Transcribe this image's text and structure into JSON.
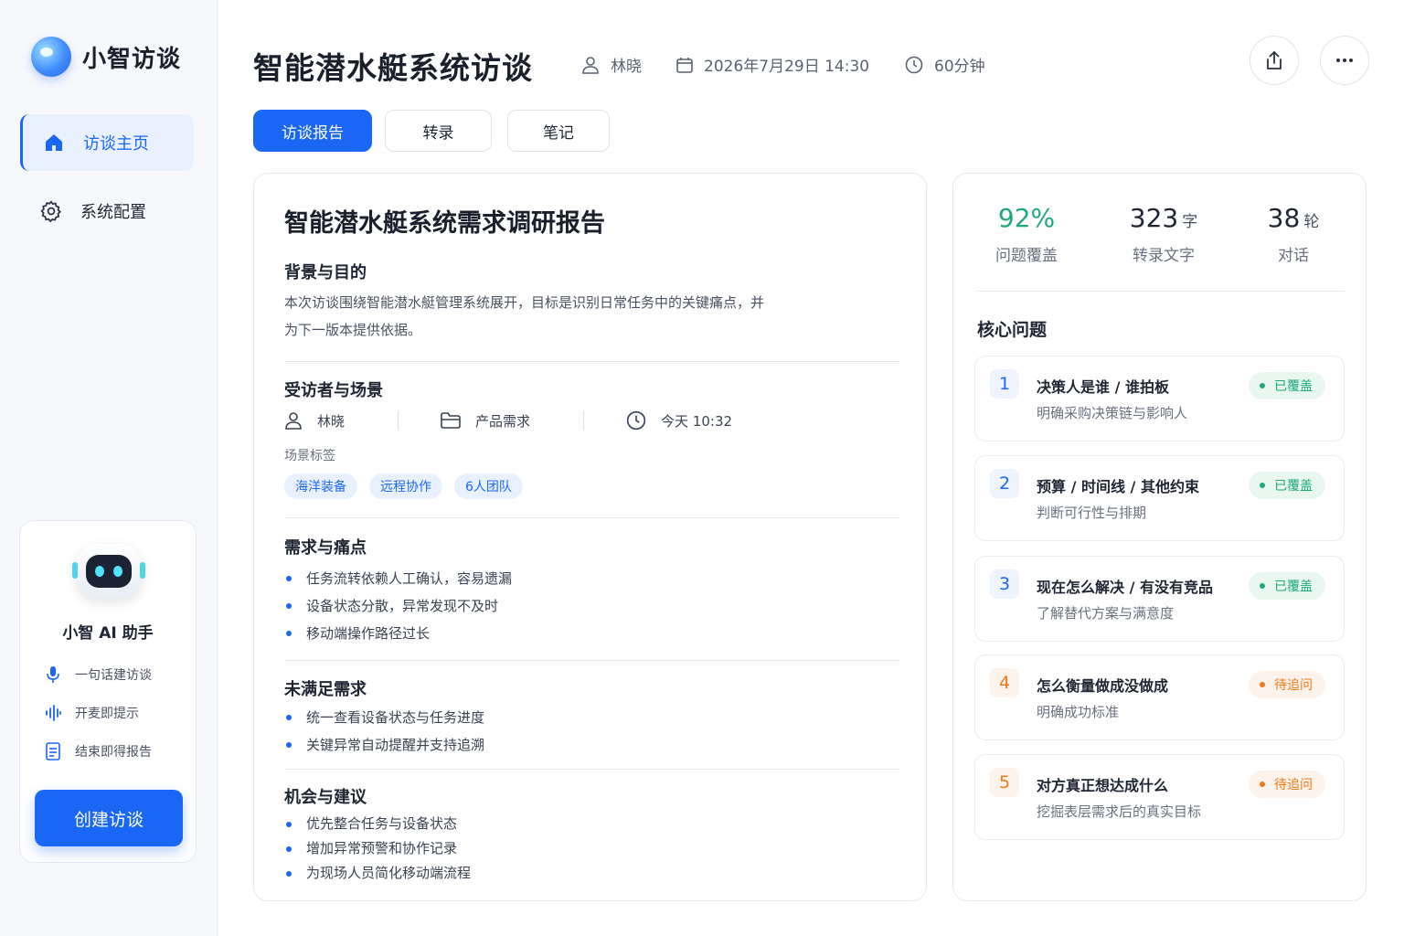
{
  "brand": {
    "name": "小智访谈"
  },
  "nav": [
    {
      "label": "访谈主页",
      "icon": "home-icon",
      "active": true
    },
    {
      "label": "系统配置",
      "icon": "gear-icon",
      "active": false
    }
  ],
  "assistant": {
    "name": "小智 AI 助手",
    "features": [
      {
        "label": "一句话建访谈",
        "icon": "microphone-icon"
      },
      {
        "label": "开麦即提示",
        "icon": "sound-wave-icon"
      },
      {
        "label": "结束即得报告",
        "icon": "document-icon"
      }
    ],
    "create_label": "创建访谈"
  },
  "header": {
    "title": "智能潜水艇系统访谈",
    "interviewer": "林晓",
    "datetime": "2026年7月29日 14:30",
    "duration": "60分钟"
  },
  "tabs": [
    {
      "label": "访谈报告",
      "active": true
    },
    {
      "label": "转录",
      "active": false
    },
    {
      "label": "笔记",
      "active": false
    }
  ],
  "report": {
    "title": "智能潜水艇系统需求调研报告",
    "background": {
      "heading": "背景与目的",
      "line1": "本次访谈围绕智能潜水艇管理系统展开，目标是识别日常任务中的关键痛点，并",
      "line2": "为下一版本提供依据。"
    },
    "interviewee": {
      "heading": "受访者与场景",
      "name": "林晓",
      "category": "产品需求",
      "time": "今天 10:32",
      "tags_label": "场景标签",
      "tags": [
        "海洋装备",
        "远程协作",
        "6人团队"
      ]
    },
    "pain_points": {
      "heading": "需求与痛点",
      "items": [
        "任务流转依赖人工确认，容易遗漏",
        "设备状态分散，异常发现不及时",
        "移动端操作路径过长"
      ]
    },
    "unmet": {
      "heading": "未满足需求",
      "items": [
        "统一查看设备状态与任务进度",
        "关键异常自动提醒并支持追溯"
      ]
    },
    "opportunities": {
      "heading": "机会与建议",
      "items": [
        "优先整合任务与设备状态",
        "增加异常预警和协作记录",
        "为现场人员简化移动端流程"
      ]
    }
  },
  "stats": [
    {
      "value": "92%",
      "unit": "",
      "label": "问题覆盖"
    },
    {
      "value": "323",
      "unit": "字",
      "label": "转录文字"
    },
    {
      "value": "38",
      "unit": "轮",
      "label": "对话"
    }
  ],
  "core": {
    "heading": "核心问题",
    "questions": [
      {
        "num": "1",
        "title": "决策人是谁 / 谁拍板",
        "sub": "明确采购决策链与影响人",
        "status": "已覆盖"
      },
      {
        "num": "2",
        "title": "预算 / 时间线 / 其他约束",
        "sub": "判断可行性与排期",
        "status": "已覆盖"
      },
      {
        "num": "3",
        "title": "现在怎么解决 / 有没有竞品",
        "sub": "了解替代方案与满意度",
        "status": "已覆盖"
      },
      {
        "num": "4",
        "title": "怎么衡量做成没做成",
        "sub": "明确成功标准",
        "status": "待追问"
      },
      {
        "num": "5",
        "title": "对方真正想达成什么",
        "sub": "挖掘表层需求后的真实目标",
        "status": "待追问"
      }
    ]
  },
  "colors": {
    "accent": "#1a66f5",
    "covered": "#1fa97a",
    "pending": "#f07a18"
  }
}
